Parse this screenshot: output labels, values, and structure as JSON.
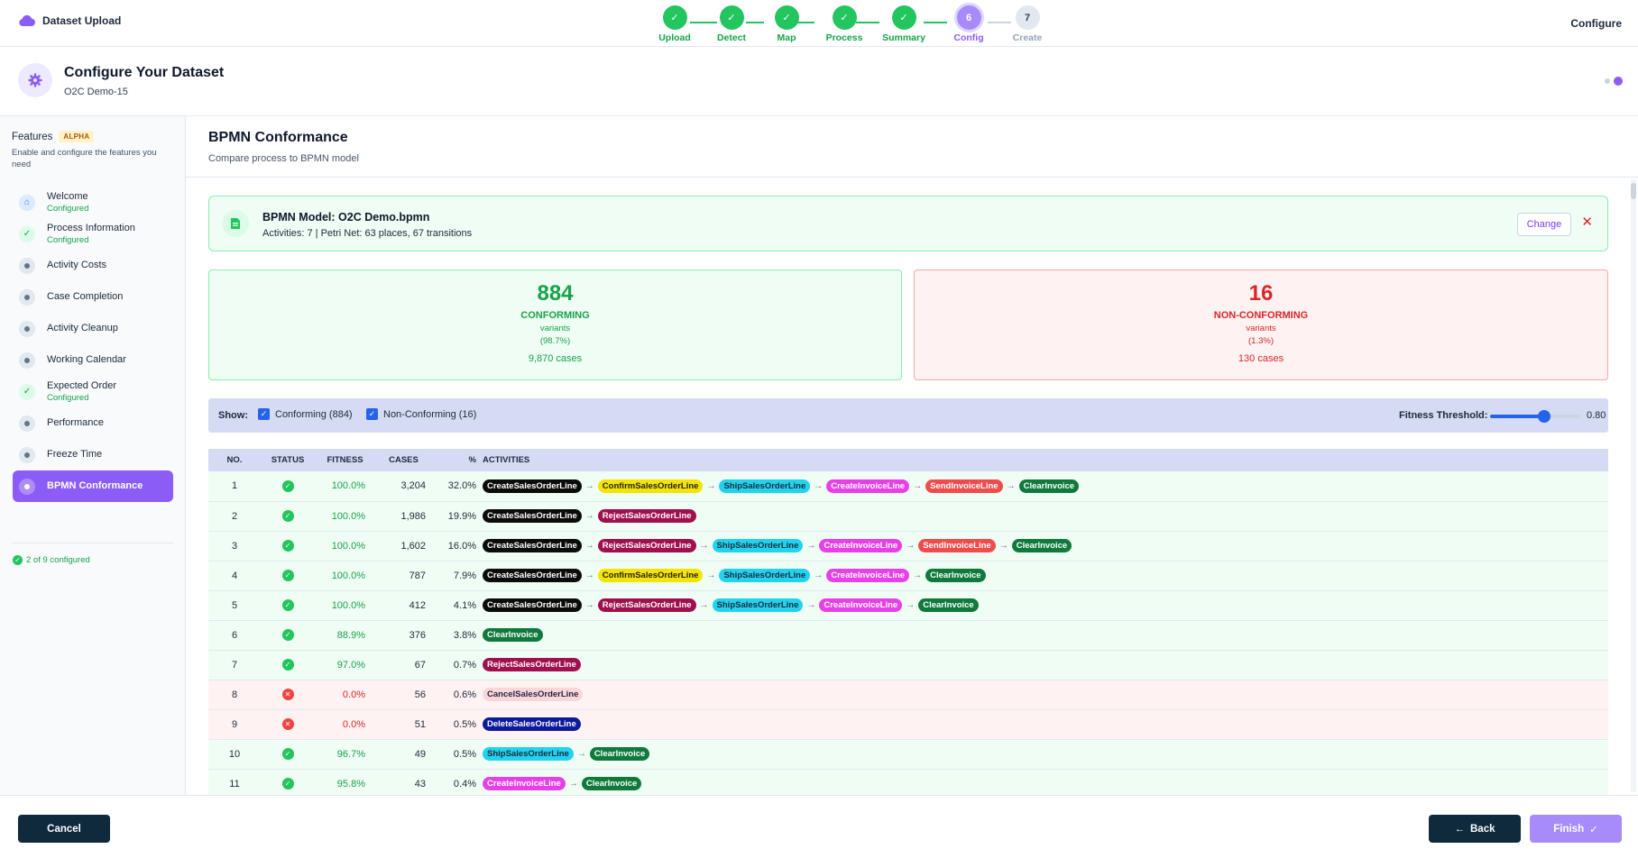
{
  "app": {
    "title": "Dataset Upload",
    "configure_link": "Configure"
  },
  "steps": [
    {
      "label": "Upload",
      "state": "done",
      "num": ""
    },
    {
      "label": "Detect",
      "state": "done",
      "num": ""
    },
    {
      "label": "Map",
      "state": "done",
      "num": ""
    },
    {
      "label": "Process",
      "state": "done",
      "num": ""
    },
    {
      "label": "Summary",
      "state": "done",
      "num": ""
    },
    {
      "label": "Config",
      "state": "current",
      "num": "6"
    },
    {
      "label": "Create",
      "state": "todo",
      "num": "7"
    }
  ],
  "header": {
    "title": "Configure Your Dataset",
    "subtitle": "O2C Demo-15"
  },
  "sidebar": {
    "title": "Features",
    "badge": "ALPHA",
    "description": "Enable and configure the features you need",
    "items": [
      {
        "label": "Welcome",
        "sub": "Configured",
        "icon": "home"
      },
      {
        "label": "Process Information",
        "sub": "Configured",
        "icon": "check"
      },
      {
        "label": "Activity Costs",
        "sub": "",
        "icon": "dot"
      },
      {
        "label": "Case Completion",
        "sub": "",
        "icon": "dot"
      },
      {
        "label": "Activity Cleanup",
        "sub": "",
        "icon": "dot"
      },
      {
        "label": "Working Calendar",
        "sub": "",
        "icon": "dot"
      },
      {
        "label": "Expected Order",
        "sub": "Configured",
        "icon": "check"
      },
      {
        "label": "Performance",
        "sub": "",
        "icon": "dot"
      },
      {
        "label": "Freeze Time",
        "sub": "",
        "icon": "dot"
      },
      {
        "label": "BPMN Conformance",
        "sub": "",
        "icon": "active"
      }
    ],
    "summary": "2 of 9 configured"
  },
  "main": {
    "title": "BPMN Conformance",
    "subtitle": "Compare process to BPMN model",
    "model": {
      "name": "BPMN Model: O2C Demo.bpmn",
      "info": "Activities: 7 | Petri Net: 63 places, 67 transitions",
      "change_label": "Change",
      "close_label": "✕"
    },
    "conforming": {
      "count": "884",
      "label": "CONFORMING",
      "unit": "variants",
      "pct": "(98.7%)",
      "cases": "9,870 cases"
    },
    "nonconforming": {
      "count": "16",
      "label": "NON-CONFORMING",
      "unit": "variants",
      "pct": "(1.3%)",
      "cases": "130 cases"
    },
    "filter": {
      "show_label": "Show:",
      "conforming_label": "Conforming (884)",
      "nonconforming_label": "Non-Conforming (16)",
      "threshold_label": "Fitness Threshold:",
      "threshold_value": "0.80",
      "threshold_fraction": 0.6
    },
    "columns": [
      "NO.",
      "STATUS",
      "FITNESS",
      "CASES",
      "%",
      "ACTIVITIES"
    ],
    "activity_colors": {
      "CreateSalesOrderLine": {
        "bg": "#0b0b0b",
        "fg": "#ffffff"
      },
      "ConfirmSalesOrderLine": {
        "bg": "#f5e400",
        "fg": "#1e1e1e"
      },
      "ShipSalesOrderLine": {
        "bg": "#22d3ee",
        "fg": "#1e293b"
      },
      "CreateInvoiceLine": {
        "bg": "#e840e8",
        "fg": "#ffffff"
      },
      "SendInvoiceLine": {
        "bg": "#ef4d4d",
        "fg": "#ffffff"
      },
      "ClearInvoice": {
        "bg": "#0f7a3c",
        "fg": "#ffffff"
      },
      "RejectSalesOrderLine": {
        "bg": "#a0104e",
        "fg": "#ffffff"
      },
      "CancelSalesOrderLine": {
        "bg": "#fbd5dc",
        "fg": "#1e293b"
      },
      "DeleteSalesOrderLine": {
        "bg": "#0c1a9c",
        "fg": "#ffffff"
      }
    },
    "rows": [
      {
        "no": "1",
        "status": "ok",
        "fitness": "100.0%",
        "cases": "3,204",
        "pct": "32.0%",
        "activities": [
          "CreateSalesOrderLine",
          "ConfirmSalesOrderLine",
          "ShipSalesOrderLine",
          "CreateInvoiceLine",
          "SendInvoiceLine",
          "ClearInvoice"
        ]
      },
      {
        "no": "2",
        "status": "ok",
        "fitness": "100.0%",
        "cases": "1,986",
        "pct": "19.9%",
        "activities": [
          "CreateSalesOrderLine",
          "RejectSalesOrderLine"
        ]
      },
      {
        "no": "3",
        "status": "ok",
        "fitness": "100.0%",
        "cases": "1,602",
        "pct": "16.0%",
        "activities": [
          "CreateSalesOrderLine",
          "RejectSalesOrderLine",
          "ShipSalesOrderLine",
          "CreateInvoiceLine",
          "SendInvoiceLine",
          "ClearInvoice"
        ]
      },
      {
        "no": "4",
        "status": "ok",
        "fitness": "100.0%",
        "cases": "787",
        "pct": "7.9%",
        "activities": [
          "CreateSalesOrderLine",
          "ConfirmSalesOrderLine",
          "ShipSalesOrderLine",
          "CreateInvoiceLine",
          "ClearInvoice"
        ]
      },
      {
        "no": "5",
        "status": "ok",
        "fitness": "100.0%",
        "cases": "412",
        "pct": "4.1%",
        "activities": [
          "CreateSalesOrderLine",
          "RejectSalesOrderLine",
          "ShipSalesOrderLine",
          "CreateInvoiceLine",
          "ClearInvoice"
        ]
      },
      {
        "no": "6",
        "status": "ok",
        "fitness": "88.9%",
        "cases": "376",
        "pct": "3.8%",
        "activities": [
          "ClearInvoice"
        ]
      },
      {
        "no": "7",
        "status": "ok",
        "fitness": "97.0%",
        "cases": "67",
        "pct": "0.7%",
        "activities": [
          "RejectSalesOrderLine"
        ]
      },
      {
        "no": "8",
        "status": "bad",
        "fitness": "0.0%",
        "cases": "56",
        "pct": "0.6%",
        "activities": [
          "CancelSalesOrderLine"
        ]
      },
      {
        "no": "9",
        "status": "bad",
        "fitness": "0.0%",
        "cases": "51",
        "pct": "0.5%",
        "activities": [
          "DeleteSalesOrderLine"
        ]
      },
      {
        "no": "10",
        "status": "ok",
        "fitness": "96.7%",
        "cases": "49",
        "pct": "0.5%",
        "activities": [
          "ShipSalesOrderLine",
          "ClearInvoice"
        ]
      },
      {
        "no": "11",
        "status": "ok",
        "fitness": "95.8%",
        "cases": "43",
        "pct": "0.4%",
        "activities": [
          "CreateInvoiceLine",
          "ClearInvoice"
        ]
      }
    ]
  },
  "footer": {
    "cancel_label": "Cancel",
    "back_label": "Back",
    "finish_label": "Finish"
  }
}
